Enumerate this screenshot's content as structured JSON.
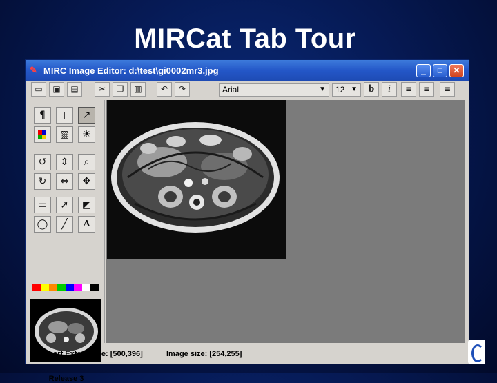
{
  "slide": {
    "title": "MIRCat Tab Tour"
  },
  "window": {
    "title": "MIRC Image Editor: d:\\test\\gi0002mr3.jpg",
    "controls": {
      "minimize": "_",
      "maximize": "□",
      "close": "✕"
    }
  },
  "toolbar": {
    "font": "Arial",
    "font_size": "12",
    "bold": "b",
    "italic": "i",
    "buttons": [
      "new-icon",
      "save-icon",
      "save-all-icon",
      "cut-icon",
      "copy-icon",
      "paste-icon",
      "undo-icon",
      "redo-icon",
      "align-left-icon",
      "align-center-icon",
      "align-right-icon"
    ]
  },
  "tools": {
    "pilcrow": "¶",
    "text_tool": "A"
  },
  "palette": [
    "#ff0000",
    "#ffff00",
    "#ff8800",
    "#00cc00",
    "#0000ff",
    "#ff00ff",
    "#ffffff",
    "#000000"
  ],
  "panel": {
    "release": "Release 3"
  },
  "status": {
    "viewport": "Viewport Extent Size: [500,396]",
    "image_size": "Image size: [254,255]"
  }
}
